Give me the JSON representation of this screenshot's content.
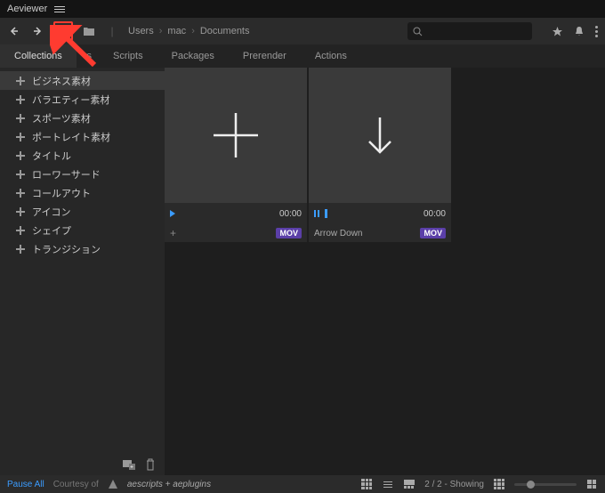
{
  "app": {
    "title": "Aeviewer"
  },
  "breadcrumb": [
    "Users",
    "mac",
    "Documents"
  ],
  "search": {
    "placeholder": ""
  },
  "tabs": [
    {
      "label": "Collections",
      "active": true
    },
    {
      "label": "rs",
      "active": false
    },
    {
      "label": "Scripts",
      "active": false
    },
    {
      "label": "Packages",
      "active": false
    },
    {
      "label": "Prerender",
      "active": false
    },
    {
      "label": "Actions",
      "active": false
    }
  ],
  "sidebar": {
    "items": [
      {
        "label": "ビジネス素材",
        "selected": true
      },
      {
        "label": "バラエティー素材",
        "selected": false
      },
      {
        "label": "スポーツ素材",
        "selected": false
      },
      {
        "label": "ポートレイト素材",
        "selected": false
      },
      {
        "label": "タイトル",
        "selected": false
      },
      {
        "label": "ローワーサード",
        "selected": false
      },
      {
        "label": "コールアウト",
        "selected": false
      },
      {
        "label": "アイコン",
        "selected": false
      },
      {
        "label": "シェイプ",
        "selected": false
      },
      {
        "label": "トランジション",
        "selected": false
      }
    ]
  },
  "files": [
    {
      "symbol": "plus",
      "name": "+",
      "time": "00:00",
      "badge": "MOV",
      "state": "play"
    },
    {
      "symbol": "arrow-down",
      "name": "Arrow Down",
      "time": "00:00",
      "badge": "MOV",
      "state": "pause"
    }
  ],
  "footer": {
    "pause": "Pause All",
    "courtesy": "Courtesy of",
    "logo": "aescripts + aeplugins",
    "status": "2 / 2 - Showing"
  }
}
